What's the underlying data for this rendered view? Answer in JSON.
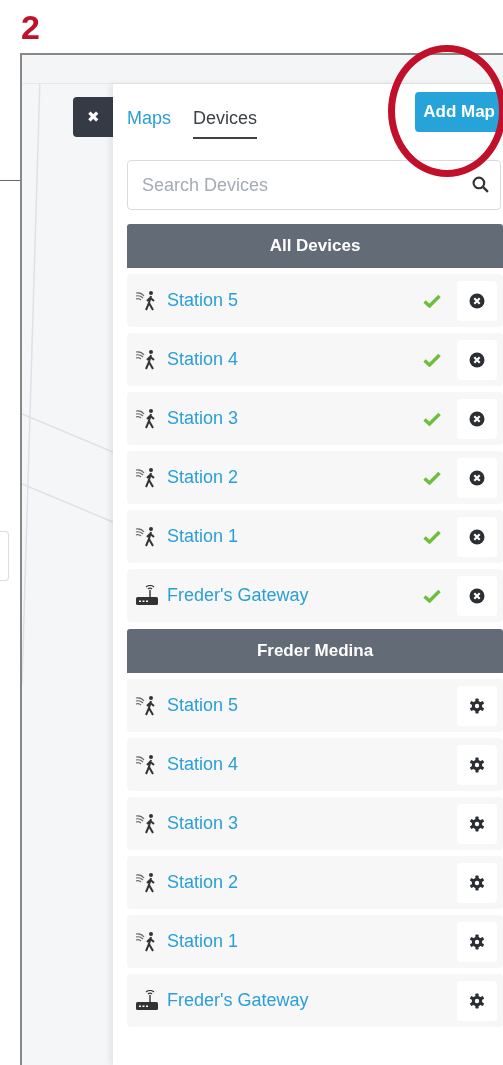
{
  "step_number": "2",
  "close_button": {
    "label": "✖"
  },
  "tabs": [
    {
      "label": "Maps",
      "selected": false
    },
    {
      "label": "Devices",
      "selected": true
    }
  ],
  "add_button": {
    "label": "Add Map",
    "highlighted": true
  },
  "search": {
    "placeholder": "Search Devices"
  },
  "groups": [
    {
      "title": "All Devices",
      "items": [
        {
          "label": "Station 5",
          "kind": "station",
          "ok": true,
          "removable": true
        },
        {
          "label": "Station 4",
          "kind": "station",
          "ok": true,
          "removable": true
        },
        {
          "label": "Station 3",
          "kind": "station",
          "ok": true,
          "removable": true
        },
        {
          "label": "Station 2",
          "kind": "station",
          "ok": true,
          "removable": true
        },
        {
          "label": "Station 1",
          "kind": "station",
          "ok": true,
          "removable": true
        },
        {
          "label": "Freder's Gateway",
          "kind": "gateway",
          "ok": true,
          "removable": true
        }
      ]
    },
    {
      "title": "Freder Medina",
      "items": [
        {
          "label": "Station 5",
          "kind": "station",
          "ok": false,
          "removable": false
        },
        {
          "label": "Station 4",
          "kind": "station",
          "ok": false,
          "removable": false
        },
        {
          "label": "Station 3",
          "kind": "station",
          "ok": false,
          "removable": false
        },
        {
          "label": "Station 2",
          "kind": "station",
          "ok": false,
          "removable": false
        },
        {
          "label": "Station 1",
          "kind": "station",
          "ok": false,
          "removable": false
        },
        {
          "label": "Freder's Gateway",
          "kind": "gateway",
          "ok": false,
          "removable": false
        }
      ]
    }
  ]
}
